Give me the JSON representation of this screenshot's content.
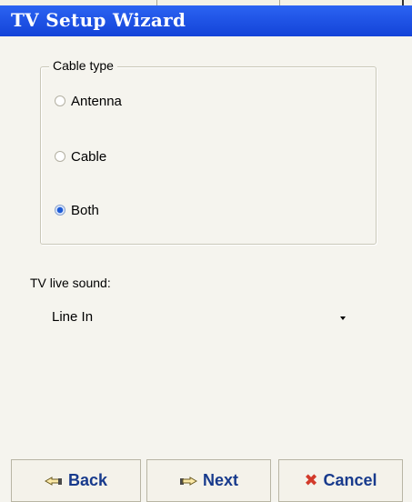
{
  "window": {
    "title": "TV Setup Wizard"
  },
  "cable_group": {
    "legend": "Cable type",
    "options": [
      {
        "label": "Antenna",
        "checked": false
      },
      {
        "label": "Cable",
        "checked": false
      },
      {
        "label": "Both",
        "checked": true
      }
    ]
  },
  "sound": {
    "label": "TV live sound:",
    "selected": "Line In"
  },
  "buttons": {
    "back": "Back",
    "next": "Next",
    "cancel": "Cancel"
  },
  "icons": {
    "back": "pointing-hand-left-icon",
    "next": "pointing-hand-right-icon",
    "cancel": "x-icon"
  },
  "colors": {
    "titlebar": "#1b4fe0",
    "button_text": "#173a8c",
    "cancel_icon": "#d23a2a",
    "radio_selected": "#1d5bd6"
  }
}
